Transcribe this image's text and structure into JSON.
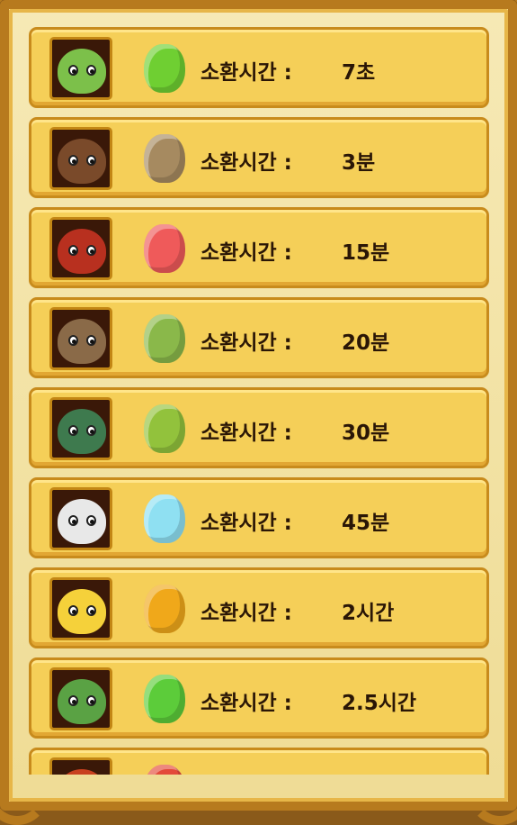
{
  "summon_list": {
    "items": [
      {
        "label": "소환시간 :",
        "time": "7초",
        "monster": "green-sprout-monster-icon",
        "gem": "green-gem-icon",
        "face_color": "#7cc04a",
        "gem_color": "#6fcf32"
      },
      {
        "label": "소환시간 :",
        "time": "3분",
        "monster": "brown-bull-monster-icon",
        "gem": "brown-gem-icon",
        "face_color": "#7a4a2a",
        "gem_color": "#a68a60"
      },
      {
        "label": "소환시간 :",
        "time": "15분",
        "monster": "red-raccoon-monster-icon",
        "gem": "red-gem-icon",
        "face_color": "#b8301f",
        "gem_color": "#ef5a5a"
      },
      {
        "label": "소환시간 :",
        "time": "20분",
        "monster": "rock-potato-monster-icon",
        "gem": "green-brown-gem-icon",
        "face_color": "#8a6a48",
        "gem_color": "#8ab84a"
      },
      {
        "label": "소환시간 :",
        "time": "30분",
        "monster": "green-duck-monster-icon",
        "gem": "green-brown-gem-icon",
        "face_color": "#3e7a4e",
        "gem_color": "#92c23c"
      },
      {
        "label": "소환시간 :",
        "time": "45분",
        "monster": "white-yeti-monster-icon",
        "gem": "light-blue-gem-icon",
        "face_color": "#e8e8e8",
        "gem_color": "#8fe0f2"
      },
      {
        "label": "소환시간 :",
        "time": "2시간",
        "monster": "yellow-chick-monster-icon",
        "gem": "orange-gem-icon",
        "face_color": "#f5d13a",
        "gem_color": "#f0a81a"
      },
      {
        "label": "소환시간 :",
        "time": "2.5시간",
        "monster": "green-dragon-monster-icon",
        "gem": "green-fire-gem-icon",
        "face_color": "#5aa244",
        "gem_color": "#5ccc3a"
      },
      {
        "label": "",
        "time": "",
        "monster": "red-mushroom-monster-icon",
        "gem": "red-gem-icon",
        "face_color": "#c8401e",
        "gem_color": "#e34a3a"
      }
    ]
  }
}
